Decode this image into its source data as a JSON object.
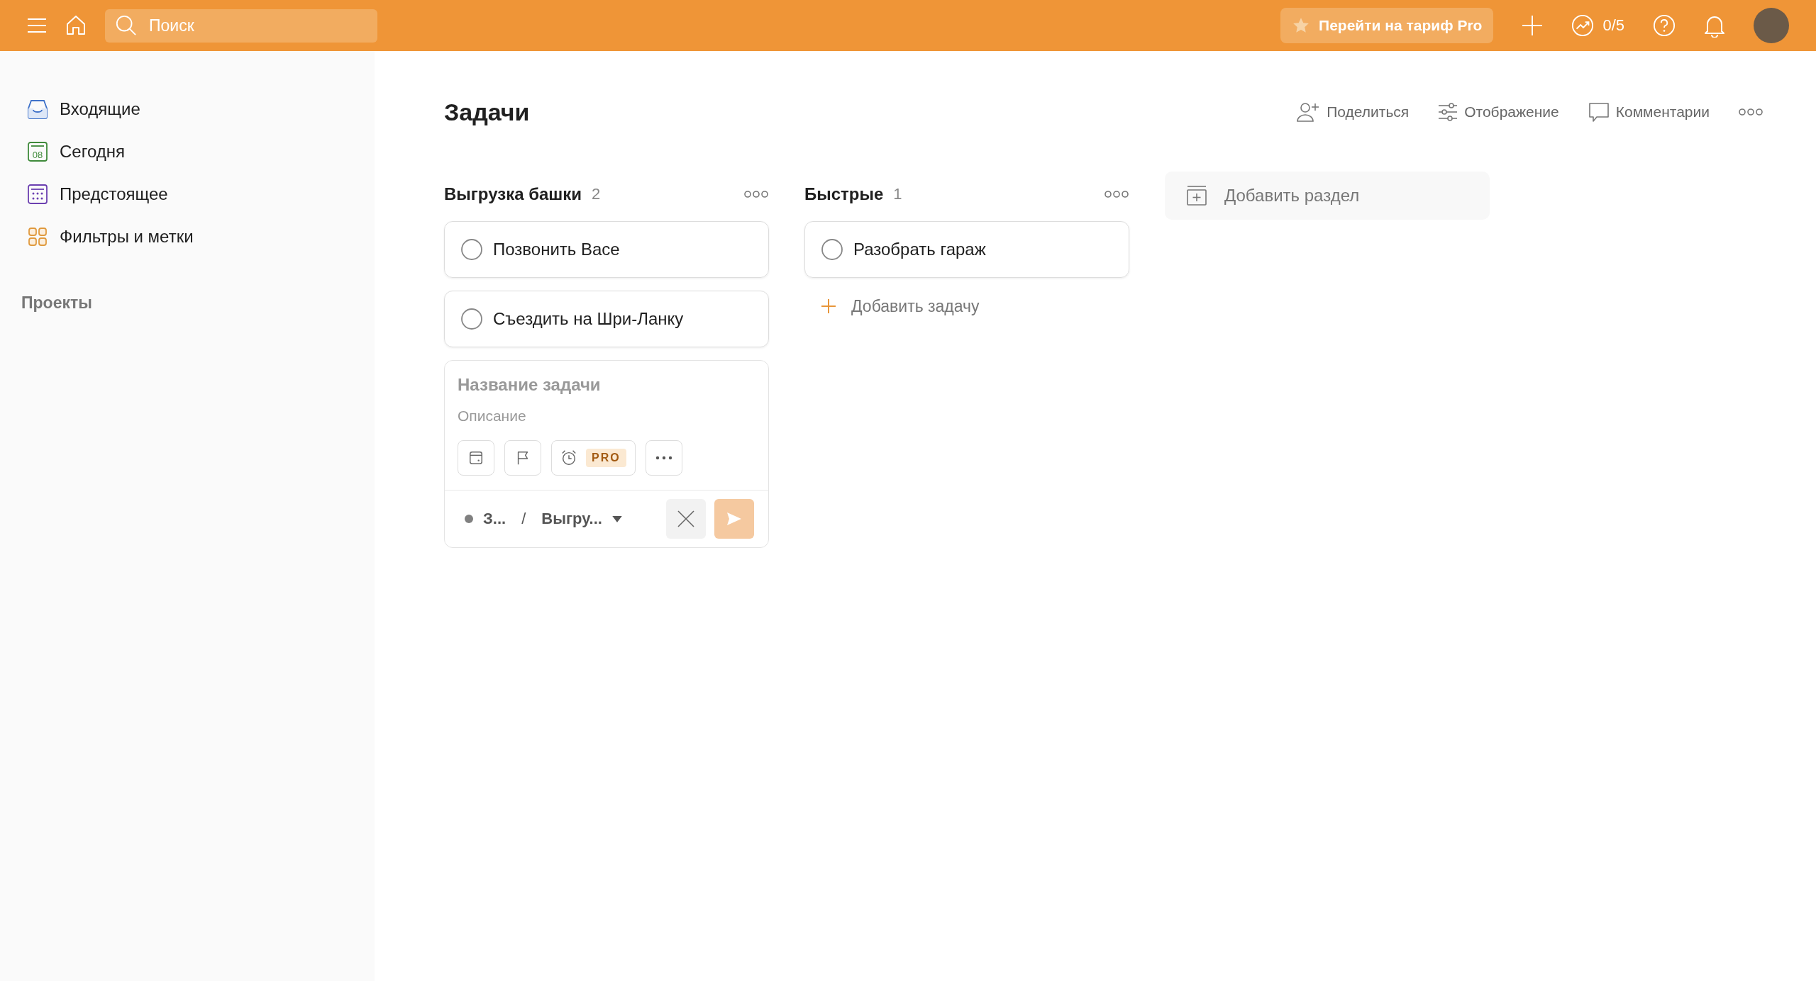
{
  "topbar": {
    "search": {
      "placeholder": "Поиск"
    },
    "upgrade_button": "Перейти на тариф Pro",
    "karma": "0/5"
  },
  "sidebar": {
    "items": [
      {
        "label": "Входящие",
        "kind": "inbox",
        "selected": false
      },
      {
        "label": "Сегодня",
        "kind": "today",
        "selected": false,
        "icon_text": "08"
      },
      {
        "label": "Предстоящее",
        "kind": "upcoming",
        "selected": false
      },
      {
        "label": "Фильтры и метки",
        "kind": "filters",
        "selected": false
      }
    ],
    "projects_heading": "Проекты"
  },
  "page": {
    "title": "Задачи",
    "actions": [
      {
        "label": "Поделиться",
        "kind": "share"
      },
      {
        "label": "Отображение",
        "kind": "view"
      },
      {
        "label": "Комментарии",
        "kind": "comments"
      }
    ]
  },
  "sections": [
    {
      "name": "Выгрузка башки",
      "count": "2",
      "tasks": [
        {
          "title": "Позвонить Васе",
          "checked": false
        },
        {
          "title": "Съездить на Шри-Ланку",
          "checked": false
        }
      ],
      "composer": {
        "title_placeholder": "Название задачи",
        "description_placeholder": "Описание",
        "reminder_badge": "PRO",
        "project": "З...",
        "separator": "/",
        "section": "Выгру...",
        "submit_disabled": true
      }
    },
    {
      "name": "Быстрые",
      "count": "1",
      "tasks": [
        {
          "title": "Разобрать гараж",
          "checked": false
        }
      ],
      "add_task": "Добавить задачу"
    }
  ],
  "add_section": "Добавить раздел"
}
